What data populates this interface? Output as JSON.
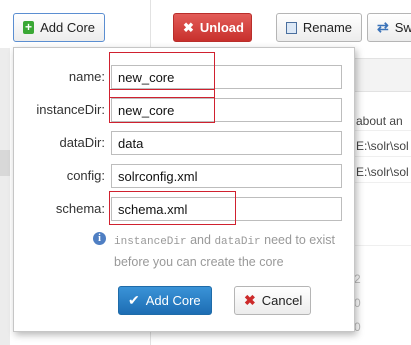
{
  "toolbar": {
    "add_core_label": "Add Core",
    "unload_label": "Unload",
    "rename_label": "Rename",
    "swap_label": "Sw"
  },
  "background": {
    "about_text": "about an",
    "path1": "E:\\solr\\sol",
    "path2": "E:\\solr\\sol",
    "num1": "2",
    "num2": "0",
    "num3": "0"
  },
  "dialog": {
    "fields": [
      {
        "label": "name:",
        "value": "new_core"
      },
      {
        "label": "instanceDir:",
        "value": "new_core"
      },
      {
        "label": "dataDir:",
        "value": "data"
      },
      {
        "label": "config:",
        "value": "solrconfig.xml"
      },
      {
        "label": "schema:",
        "value": "schema.xml"
      }
    ],
    "info": {
      "code1": "instanceDir",
      "and": " and ",
      "code2": "dataDir",
      "rest": " need to exist before you can create the core"
    },
    "submit_label": "Add Core",
    "cancel_label": "Cancel"
  },
  "colors": {
    "highlight": "#d0212f",
    "unload_red": "#c8302c",
    "submit_blue": "#1d6db3"
  }
}
